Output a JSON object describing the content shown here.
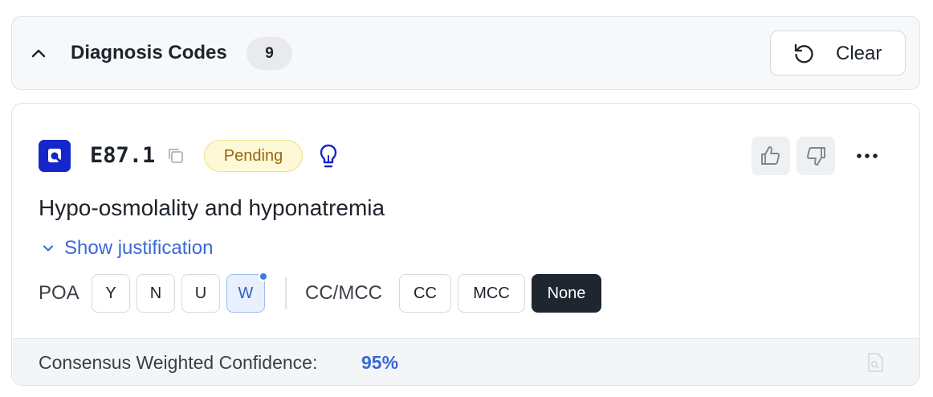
{
  "header": {
    "title": "Diagnosis Codes",
    "count": "9",
    "clear_label": "Clear"
  },
  "code_card": {
    "code": "E87.1",
    "status": "Pending",
    "description": "Hypo-osmolality and hyponatremia",
    "justification_label": "Show justification",
    "poa": {
      "label": "POA",
      "options": [
        "Y",
        "N",
        "U",
        "W"
      ],
      "selected": "W"
    },
    "cc_mcc": {
      "label": "CC/MCC",
      "options": [
        "CC",
        "MCC",
        "None"
      ],
      "selected": "None"
    },
    "footer": {
      "confidence_label": "Consensus Weighted Confidence:",
      "confidence_value": "95%"
    }
  },
  "icons": {
    "collapse": "chevron-up-icon",
    "clear": "refresh-icon",
    "code_type": "app-logo-icon",
    "copy": "copy-icon",
    "insight": "lightbulb-icon",
    "like": "thumbs-up-icon",
    "dislike": "thumbs-down-icon",
    "more": "more-horizontal-icon",
    "justification": "chevron-down-icon",
    "document": "document-search-icon"
  },
  "colors": {
    "brand": "#1627c9",
    "link": "#3a68d8",
    "pending_bg": "#fdf8d7",
    "pending_text": "#9a6612",
    "selected_poa": "#e8f0fd",
    "selected_ccmcc": "#1f2630"
  }
}
